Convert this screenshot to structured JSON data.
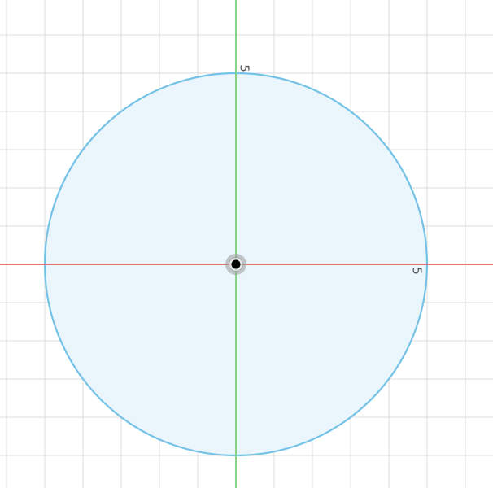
{
  "sketch": {
    "colors": {
      "background": "#ffffff",
      "grid_line": "#dcdcdc",
      "x_axis": "#e06666",
      "y_axis": "#7ccd7c",
      "circle_stroke": "#74c2e6",
      "circle_fill": "#eaf5fc",
      "origin_halo": "#9a9a9a",
      "origin_point": "#000000",
      "tick_label": "#555555"
    },
    "grid": {
      "visible": true,
      "minor_step_units": 1
    },
    "axes": {
      "x_tick_label": "5",
      "y_tick_label": "5",
      "x_tick_value": 5,
      "y_tick_value": 5
    },
    "circle": {
      "center_x": 0,
      "center_y": 0,
      "radius": 5
    },
    "origin": {
      "x": 0,
      "y": 0
    }
  }
}
